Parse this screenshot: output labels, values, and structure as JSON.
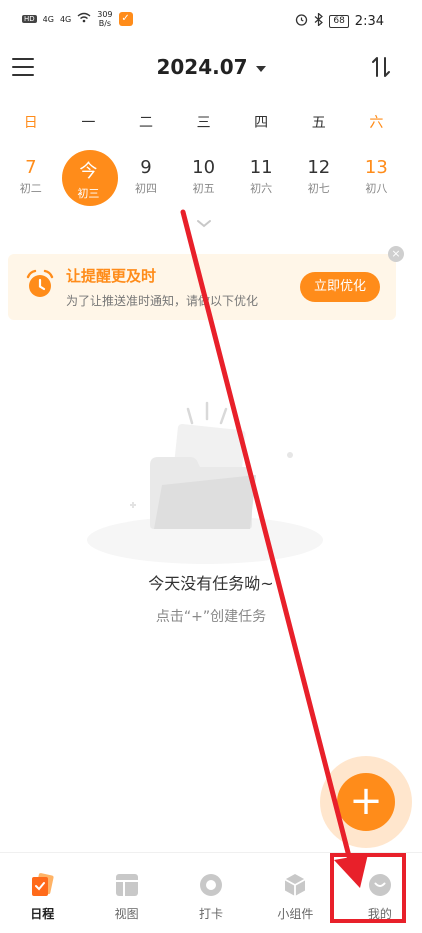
{
  "status_bar": {
    "hd_label": "HD",
    "signal1": "4G",
    "signal2": "4G",
    "speed_value": "309",
    "speed_unit": "B/s",
    "battery": "68",
    "time": "2:34"
  },
  "header": {
    "month": "2024.07"
  },
  "week": {
    "weekday_labels": [
      "日",
      "一",
      "二",
      "三",
      "四",
      "五",
      "六"
    ],
    "days": [
      {
        "num": "7",
        "lunar": "初二"
      },
      {
        "num": "今",
        "lunar": "初三"
      },
      {
        "num": "9",
        "lunar": "初四"
      },
      {
        "num": "10",
        "lunar": "初五"
      },
      {
        "num": "11",
        "lunar": "初六"
      },
      {
        "num": "12",
        "lunar": "初七"
      },
      {
        "num": "13",
        "lunar": "初八"
      }
    ]
  },
  "banner": {
    "title": "让提醒更及时",
    "desc": "为了让推送准时通知，请做以下优化",
    "button": "立即优化",
    "close": "×"
  },
  "empty_state": {
    "title": "今天没有任务呦~",
    "subtitle": "点击“+”创建任务"
  },
  "fab": {
    "label": "+"
  },
  "bottom_nav": [
    {
      "label": "日程",
      "icon": "calendar-cards-icon",
      "active": true
    },
    {
      "label": "视图",
      "icon": "view-grid-icon",
      "active": false
    },
    {
      "label": "打卡",
      "icon": "checkin-ring-icon",
      "active": false
    },
    {
      "label": "小组件",
      "icon": "widget-cube-icon",
      "active": false
    },
    {
      "label": "我的",
      "icon": "profile-icon",
      "active": false
    }
  ],
  "colors": {
    "accent": "#ff8c1a",
    "annotation": "#e8202a",
    "banner_bg": "#fff6e8"
  }
}
